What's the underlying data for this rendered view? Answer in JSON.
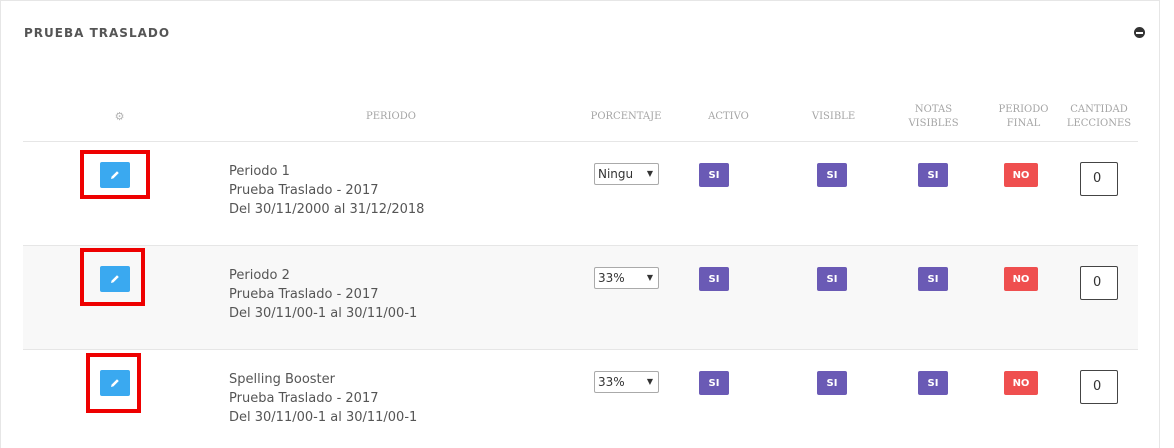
{
  "panel": {
    "title": "PRUEBA TRASLADO"
  },
  "icons": {
    "collapse": "minus-circle-icon",
    "settings": "gear-icon",
    "edit": "pencil-icon"
  },
  "colors": {
    "edit_button": "#3aa9f0",
    "badge_si": "#6a5ab5",
    "badge_no": "#ef4f4f",
    "highlight_frame": "#ee0000"
  },
  "headers": {
    "periodo": "PERIODO",
    "porcentaje": "PORCENTAJE",
    "activo": "ACTIVO",
    "visible": "VISIBLE",
    "notas_visibles": [
      "NOTAS",
      "VISIBLES"
    ],
    "periodo_final": [
      "PERIODO",
      "FINAL"
    ],
    "cantidad_lecciones": [
      "CANTIDAD",
      "LECCIONES"
    ]
  },
  "rows": [
    {
      "name": "Periodo 1",
      "group": "Prueba Traslado - 2017",
      "dates": "Del 30/11/2000 al 31/12/2018",
      "porcentaje": "Ningu",
      "activo": "SI",
      "visible": "SI",
      "notas_visibles": "SI",
      "periodo_final": "NO",
      "cantidad_lecciones": "0"
    },
    {
      "name": "Periodo 2",
      "group": "Prueba Traslado - 2017",
      "dates": "Del 30/11/00-1 al 30/11/00-1",
      "porcentaje": "33%",
      "activo": "SI",
      "visible": "SI",
      "notas_visibles": "SI",
      "periodo_final": "NO",
      "cantidad_lecciones": "0"
    },
    {
      "name": "Spelling Booster",
      "group": "Prueba Traslado - 2017",
      "dates": "Del 30/11/00-1 al 30/11/00-1",
      "porcentaje": "33%",
      "activo": "SI",
      "visible": "SI",
      "notas_visibles": "SI",
      "periodo_final": "NO",
      "cantidad_lecciones": "0"
    }
  ]
}
